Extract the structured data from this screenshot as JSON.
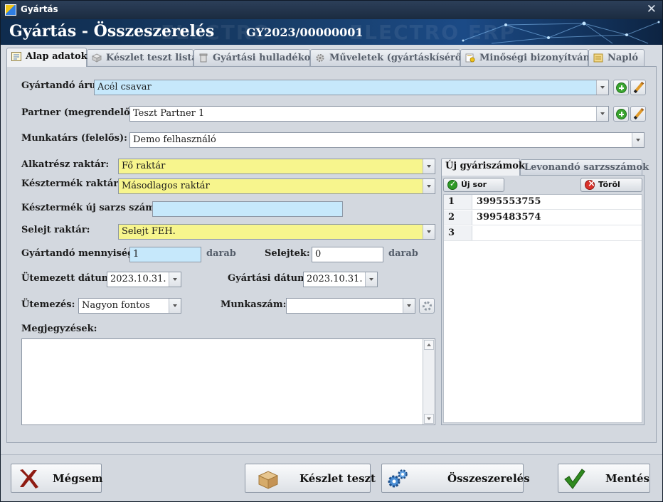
{
  "window": {
    "title": "Gyártás",
    "close_glyph": "✕"
  },
  "header": {
    "title": "Gyártás - Összeszerelés",
    "doc_number": "GY2023/00000001",
    "watermark_a": "ELECTRO",
    "watermark_b": "ELECTRO ERP"
  },
  "tabs": [
    {
      "label": "Alap adatok",
      "icon": "form-icon",
      "active": true
    },
    {
      "label": "Készlet teszt lista",
      "icon": "cube-icon",
      "active": false
    },
    {
      "label": "Gyártási hulladékok",
      "icon": "bin-icon",
      "active": false
    },
    {
      "label": "Műveletek (gyártáskísérő)",
      "icon": "gear-icon",
      "active": false
    },
    {
      "label": "Minőségi bizonyítvány",
      "icon": "certificate-icon",
      "active": false
    },
    {
      "label": "Napló",
      "icon": "log-icon",
      "active": false
    }
  ],
  "form": {
    "product": {
      "label": "Gyártandó áru:",
      "value": "Acél csavar"
    },
    "partner": {
      "label": "Partner (megrendelő):",
      "value": "Teszt Partner 1"
    },
    "employee": {
      "label": "Munkatárs (felelős):",
      "value": "Demo felhasználó"
    },
    "parts_warehouse": {
      "label": "Alkatrész raktár:",
      "value": "Fő raktár"
    },
    "product_warehouse": {
      "label": "Késztermék raktár:",
      "value": "Másodlagos raktár"
    },
    "new_batch": {
      "label": "Késztermék új sarzs szám:",
      "value": ""
    },
    "reject_warehouse": {
      "label": "Selejt raktár:",
      "value": "Selejt FEH."
    },
    "quantity": {
      "label": "Gyártandó mennyiség:",
      "value": "1",
      "unit": "darab"
    },
    "rejects": {
      "label": "Selejtek:",
      "value": "0",
      "unit": "darab"
    },
    "scheduled_date": {
      "label": "Ütemezett dátum:",
      "value": "2023.10.31."
    },
    "production_date": {
      "label": "Gyártási dátum:",
      "value": "2023.10.31."
    },
    "priority": {
      "label": "Ütemezés:",
      "value": "Nagyon fontos"
    },
    "work_number": {
      "label": "Munkaszám:",
      "value": ""
    },
    "notes": {
      "label": "Megjegyzések:",
      "value": ""
    }
  },
  "serials": {
    "tabs": [
      {
        "label": "Új gyáriszámok",
        "active": true
      },
      {
        "label": "Levonandó sarzsszámok",
        "active": false
      }
    ],
    "new_row_label": "Új sor",
    "delete_label": "Töröl",
    "rows": [
      {
        "index": "1",
        "value": "3995553755"
      },
      {
        "index": "2",
        "value": "3995483574"
      },
      {
        "index": "3",
        "value": ""
      }
    ]
  },
  "actions": {
    "cancel": "Mégsem",
    "stock_test": "Készlet teszt",
    "assemble": "Összeszerelés",
    "save": "Mentés"
  },
  "colors": {
    "required_field": "#f7f58d",
    "info_field": "#c6e8fb",
    "banner": "#183e6a"
  }
}
